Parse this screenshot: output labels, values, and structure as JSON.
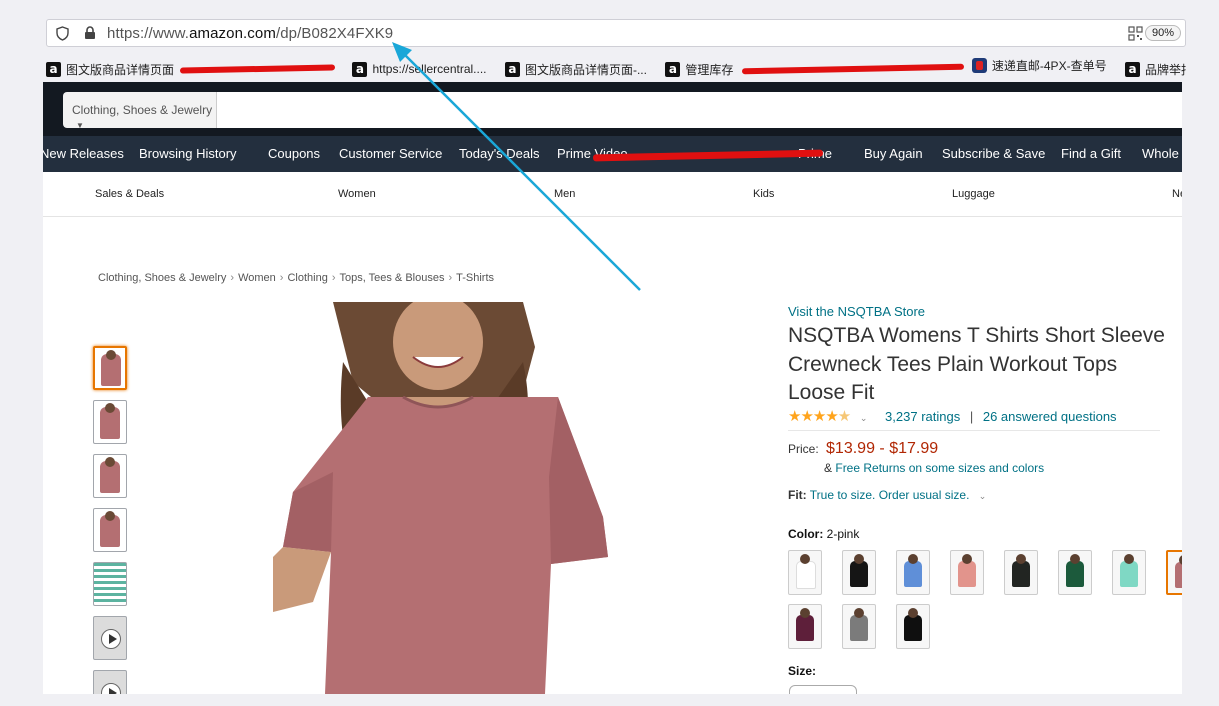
{
  "browser": {
    "url_prefix": "https://www.",
    "url_domain": "amazon.com",
    "url_path": "/dp/B082X4FXK9",
    "zoom": "90%"
  },
  "bookmarks": [
    {
      "label": "图文版商品详情页面"
    },
    {
      "label": "https://sellercentral...."
    },
    {
      "label": "图文版商品详情页面-..."
    },
    {
      "label": "管理库存"
    },
    {
      "label": "速递直邮-4PX-查单号"
    },
    {
      "label": "品牌举报"
    }
  ],
  "header": {
    "search_department": "Clothing, Shoes & Jewelry"
  },
  "nav": {
    "items": [
      "New Releases",
      "Browsing History",
      "Coupons",
      "Customer Service",
      "Today's Deals",
      "Prime Video",
      "Prime",
      "Buy Again",
      "Subscribe & Save",
      "Find a Gift",
      "Whole"
    ]
  },
  "subnav": {
    "items": [
      "Sales & Deals",
      "Women",
      "Men",
      "Kids",
      "Luggage",
      "Ne"
    ]
  },
  "breadcrumb": [
    "Clothing, Shoes & Jewelry",
    "Women",
    "Clothing",
    "Tops, Tees & Blouses",
    "T-Shirts"
  ],
  "product": {
    "store_link": "Visit the NSQTBA Store",
    "title": "NSQTBA Womens T Shirts Short Sleeve Crewneck Tees Plain Workout Tops Loose Fit",
    "rating_stars": 4.5,
    "ratings": "3,237 ratings",
    "answered": "26 answered questions",
    "price_label": "Price:",
    "price": "$13.99 - $17.99",
    "returns_prefix": "&",
    "returns_link": "Free Returns on some sizes and colors",
    "fit_label": "Fit:",
    "fit_value": "True to size. Order usual size.",
    "color_label": "Color:",
    "color_value": "2-pink",
    "size_label": "Size:"
  },
  "colors": {
    "swatches": [
      "#ffffff",
      "#151515",
      "#5f8fd8",
      "#e2948c",
      "#222522",
      "#1c5a3c",
      "#7fd8c4",
      "#b46f72",
      "#5e1f3a",
      "#7b7b7b",
      "#0f0f0f"
    ],
    "selected_index": 7,
    "accent": "#e77600",
    "link": "#007185",
    "price": "#b12704",
    "nav_bg": "#232f3e",
    "header_bg": "#131921",
    "annotation_arrow": "#1aa7d8",
    "redaction": "#e01010"
  }
}
